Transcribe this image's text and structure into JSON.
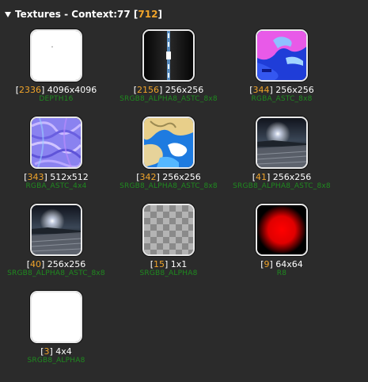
{
  "header": {
    "title": "Textures - Context:77",
    "count": "712"
  },
  "textures": [
    {
      "id": "2336",
      "size": "4096x4096",
      "format": "DEPTH16",
      "thumb": "white-dot"
    },
    {
      "id": "2156",
      "size": "256x256",
      "format": "SRGB8_ALPHA8_ASTC_8x8",
      "thumb": "lightbar"
    },
    {
      "id": "344",
      "size": "256x256",
      "format": "RGBA_ASTC_8x8",
      "thumb": "pink-blue"
    },
    {
      "id": "343",
      "size": "512x512",
      "format": "RGBA_ASTC_4x4",
      "thumb": "normal-map"
    },
    {
      "id": "342",
      "size": "256x256",
      "format": "SRGB8_ALPHA8_ASTC_8x8",
      "thumb": "yellow-blue"
    },
    {
      "id": "41",
      "size": "256x256",
      "format": "SRGB8_ALPHA8_ASTC_8x8",
      "thumb": "night-sky"
    },
    {
      "id": "40",
      "size": "256x256",
      "format": "SRGB8_ALPHA8_ASTC_8x8",
      "thumb": "night-sky"
    },
    {
      "id": "15",
      "size": "1x1",
      "format": "SRGB8_ALPHA8",
      "thumb": "checker"
    },
    {
      "id": "9",
      "size": "64x64",
      "format": "R8",
      "thumb": "red-radial"
    },
    {
      "id": "3",
      "size": "4x4",
      "format": "SRGB8_ALPHA8",
      "thumb": "white"
    }
  ]
}
